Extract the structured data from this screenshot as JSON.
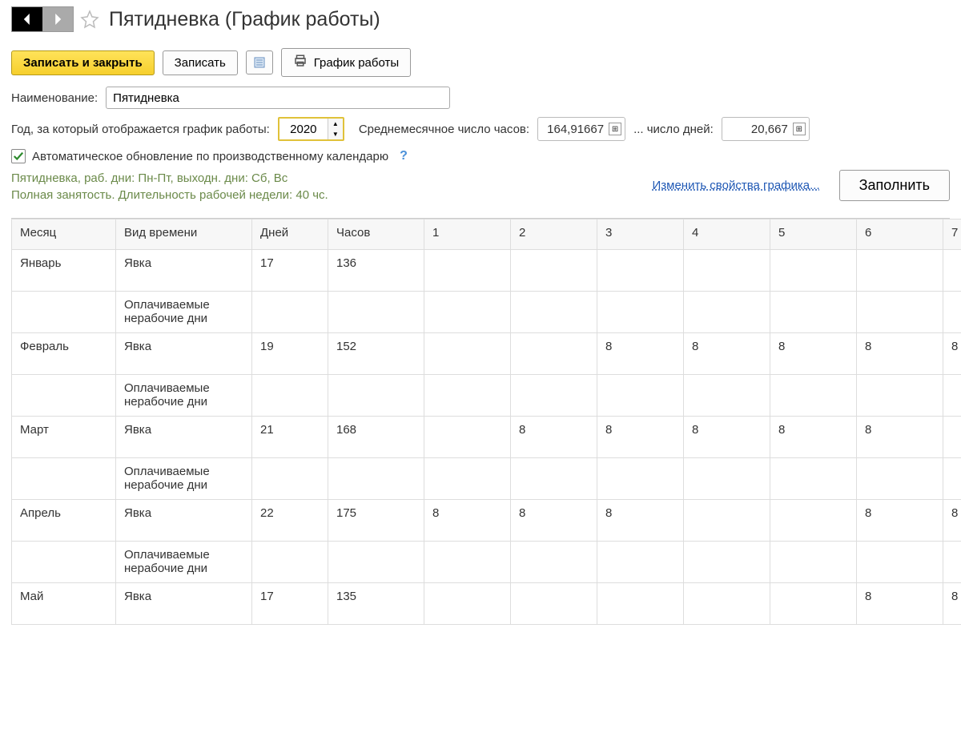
{
  "header": {
    "title": "Пятидневка (График работы)"
  },
  "toolbar": {
    "save_close": "Записать и закрыть",
    "save": "Записать",
    "schedule_btn": "График работы"
  },
  "fields": {
    "name_label": "Наименование:",
    "name_value": "Пятидневка",
    "year_label": "Год, за который отображается график работы:",
    "year_value": "2020",
    "avg_hours_label": "Среднемесячное число часов:",
    "avg_hours_value": "164,91667",
    "avg_days_label": "... число дней:",
    "avg_days_value": "20,667",
    "auto_update_label": "Автоматическое обновление по производственному календарю",
    "auto_update_checked": true
  },
  "info": {
    "line1": "Пятидневка, раб. дни: Пн-Пт, выходн. дни: Сб, Вс",
    "line2": "Полная занятость. Длительность рабочей недели: 40 чс."
  },
  "actions": {
    "change_link": "Изменить свойства графика...",
    "fill_btn": "Заполнить"
  },
  "grid": {
    "headers": {
      "month": "Месяц",
      "type": "Вид времени",
      "days": "Дней",
      "hours": "Часов",
      "d1": "1",
      "d2": "2",
      "d3": "3",
      "d4": "4",
      "d5": "5",
      "d6": "6",
      "d7": "7"
    },
    "type_labels": {
      "attend": "Явка",
      "paid_off": "Оплачиваемые нерабочие дни"
    },
    "months": [
      {
        "name": "Январь",
        "attend": {
          "days": "17",
          "hours": "136",
          "cells": [
            {
              "v": "",
              "c": "pinklight"
            },
            {
              "v": "",
              "c": "pinklight"
            },
            {
              "v": "",
              "c": "pinklight"
            },
            {
              "v": "",
              "c": "pinklight"
            },
            {
              "v": "",
              "c": "pinklight"
            },
            {
              "v": "",
              "c": "pinklight"
            },
            {
              "v": "",
              "c": "pinklight"
            }
          ],
          "hl": true
        },
        "paid_off": {
          "cells": [
            {
              "v": "",
              "c": "pink"
            },
            {
              "v": "",
              "c": "pink"
            },
            {
              "v": "",
              "c": "pink"
            },
            {
              "v": "",
              "c": "pink"
            },
            {
              "v": "",
              "c": "pink"
            },
            {
              "v": "",
              "c": "pink"
            },
            {
              "v": "",
              "c": "pink"
            }
          ]
        }
      },
      {
        "name": "Февраль",
        "attend": {
          "days": "19",
          "hours": "152",
          "cells": [
            {
              "v": "",
              "c": "pink"
            },
            {
              "v": "",
              "c": "pink"
            },
            {
              "v": "8",
              "c": ""
            },
            {
              "v": "8",
              "c": ""
            },
            {
              "v": "8",
              "c": ""
            },
            {
              "v": "8",
              "c": ""
            },
            {
              "v": "8",
              "c": ""
            }
          ]
        },
        "paid_off": {
          "cells": [
            {
              "v": "",
              "c": "pink"
            },
            {
              "v": "",
              "c": "pink"
            },
            {
              "v": "",
              "c": ""
            },
            {
              "v": "",
              "c": ""
            },
            {
              "v": "",
              "c": ""
            },
            {
              "v": "",
              "c": ""
            },
            {
              "v": "",
              "c": ""
            }
          ]
        }
      },
      {
        "name": "Март",
        "attend": {
          "days": "21",
          "hours": "168",
          "cells": [
            {
              "v": "",
              "c": "pink"
            },
            {
              "v": "8",
              "c": ""
            },
            {
              "v": "8",
              "c": ""
            },
            {
              "v": "8",
              "c": ""
            },
            {
              "v": "8",
              "c": ""
            },
            {
              "v": "8",
              "c": ""
            },
            {
              "v": "",
              "c": "pink"
            }
          ]
        },
        "paid_off": {
          "cells": [
            {
              "v": "",
              "c": "pink"
            },
            {
              "v": "",
              "c": ""
            },
            {
              "v": "",
              "c": ""
            },
            {
              "v": "",
              "c": ""
            },
            {
              "v": "",
              "c": ""
            },
            {
              "v": "",
              "c": ""
            },
            {
              "v": "",
              "c": "pink"
            }
          ]
        }
      },
      {
        "name": "Апрель",
        "attend": {
          "days": "22",
          "hours": "175",
          "cells": [
            {
              "v": "8",
              "c": ""
            },
            {
              "v": "8",
              "c": ""
            },
            {
              "v": "8",
              "c": ""
            },
            {
              "v": "",
              "c": "pink"
            },
            {
              "v": "",
              "c": "pink"
            },
            {
              "v": "8",
              "c": ""
            },
            {
              "v": "8",
              "c": ""
            }
          ]
        },
        "paid_off": {
          "cells": [
            {
              "v": "",
              "c": ""
            },
            {
              "v": "",
              "c": ""
            },
            {
              "v": "",
              "c": ""
            },
            {
              "v": "",
              "c": "pink"
            },
            {
              "v": "",
              "c": "pink"
            },
            {
              "v": "",
              "c": ""
            },
            {
              "v": "",
              "c": ""
            }
          ]
        }
      },
      {
        "name": "Май",
        "attend": {
          "days": "17",
          "hours": "135",
          "cells": [
            {
              "v": "",
              "c": "pink"
            },
            {
              "v": "",
              "c": "pink"
            },
            {
              "v": "",
              "c": "pink"
            },
            {
              "v": "",
              "c": "pink"
            },
            {
              "v": "",
              "c": "pink"
            },
            {
              "v": "8",
              "c": ""
            },
            {
              "v": "8",
              "c": ""
            }
          ]
        }
      }
    ]
  }
}
